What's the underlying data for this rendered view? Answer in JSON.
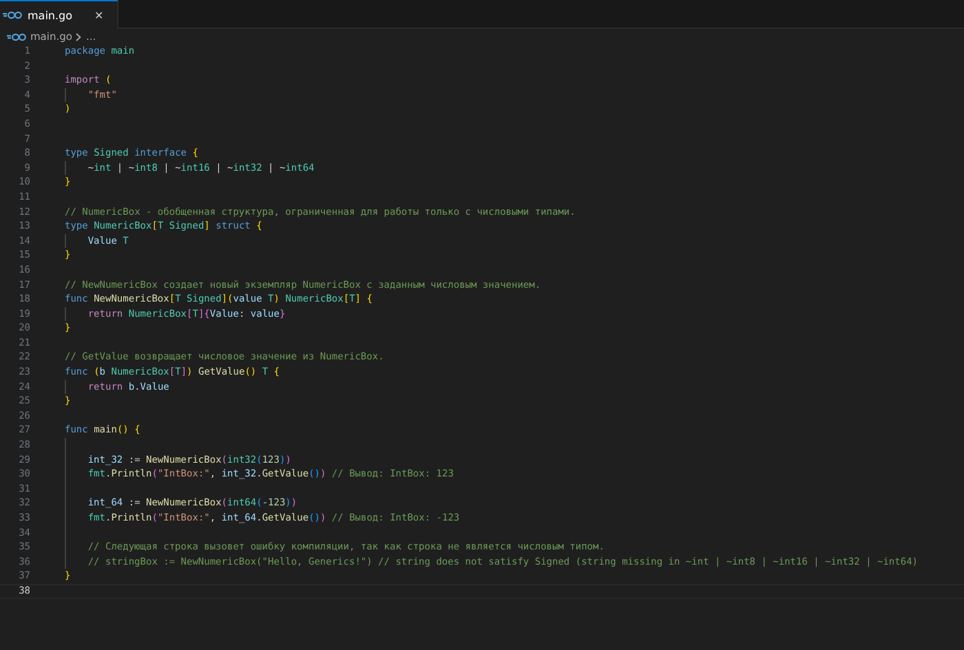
{
  "tabs": [
    {
      "label": "main.go",
      "selected": true,
      "close": "✕"
    }
  ],
  "breadcrumb": {
    "file": "main.go",
    "rest": "..."
  },
  "lines": [
    {
      "number": "1",
      "current": false,
      "indented": false,
      "tokens": [
        {
          "kind": "kw",
          "text": "package "
        },
        {
          "kind": "type",
          "text": "main"
        }
      ]
    },
    {
      "number": "2",
      "current": false,
      "indented": false
    },
    {
      "number": "3",
      "current": false,
      "indented": false,
      "tokens": [
        {
          "kind": "ctrl",
          "text": "import "
        },
        {
          "kind": "br1",
          "text": "("
        }
      ]
    },
    {
      "number": "4",
      "current": false,
      "indented": true,
      "tokens": [
        {
          "kind": "str",
          "text": "\"fmt\""
        }
      ]
    },
    {
      "number": "5",
      "current": false,
      "indented": false,
      "tokens": [
        {
          "kind": "br1",
          "text": ")"
        }
      ]
    },
    {
      "number": "6",
      "current": false,
      "indented": false
    },
    {
      "number": "7",
      "current": false,
      "indented": false
    },
    {
      "number": "8",
      "current": false,
      "indented": false,
      "tokens": [
        {
          "kind": "kw",
          "text": "type "
        },
        {
          "kind": "type",
          "text": "Signed "
        },
        {
          "kind": "kw",
          "text": "interface "
        },
        {
          "kind": "br1",
          "text": "{"
        }
      ]
    },
    {
      "number": "9",
      "current": false,
      "indented": true,
      "tokens": [
        {
          "kind": "punct",
          "text": "~"
        },
        {
          "kind": "type",
          "text": "int"
        },
        {
          "kind": "punct",
          "text": " | ~"
        },
        {
          "kind": "type",
          "text": "int8"
        },
        {
          "kind": "punct",
          "text": " | ~"
        },
        {
          "kind": "type",
          "text": "int16"
        },
        {
          "kind": "punct",
          "text": " | ~"
        },
        {
          "kind": "type",
          "text": "int32"
        },
        {
          "kind": "punct",
          "text": " | ~"
        },
        {
          "kind": "type",
          "text": "int64"
        }
      ]
    },
    {
      "number": "10",
      "current": false,
      "indented": false,
      "tokens": [
        {
          "kind": "br1",
          "text": "}"
        }
      ]
    },
    {
      "number": "11",
      "current": false,
      "indented": false
    },
    {
      "number": "12",
      "current": false,
      "indented": false,
      "tokens": [
        {
          "kind": "cm",
          "text": "// NumericBox - обобщенная структура, ограниченная для работы только с числовыми типами."
        }
      ]
    },
    {
      "number": "13",
      "current": false,
      "indented": false,
      "tokens": [
        {
          "kind": "kw",
          "text": "type "
        },
        {
          "kind": "type",
          "text": "NumericBox"
        },
        {
          "kind": "br1",
          "text": "["
        },
        {
          "kind": "type",
          "text": "T Signed"
        },
        {
          "kind": "br1",
          "text": "]"
        },
        {
          "kind": "kw",
          "text": " struct "
        },
        {
          "kind": "br1",
          "text": "{"
        }
      ]
    },
    {
      "number": "14",
      "current": false,
      "indented": true,
      "tokens": [
        {
          "kind": "var",
          "text": "Value "
        },
        {
          "kind": "type",
          "text": "T"
        }
      ]
    },
    {
      "number": "15",
      "current": false,
      "indented": false,
      "tokens": [
        {
          "kind": "br1",
          "text": "}"
        }
      ]
    },
    {
      "number": "16",
      "current": false,
      "indented": false
    },
    {
      "number": "17",
      "current": false,
      "indented": false,
      "tokens": [
        {
          "kind": "cm",
          "text": "// NewNumericBox создает новый экземпляр NumericBox с заданным числовым значением."
        }
      ]
    },
    {
      "number": "18",
      "current": false,
      "indented": false,
      "tokens": [
        {
          "kind": "kw",
          "text": "func "
        },
        {
          "kind": "fn",
          "text": "NewNumericBox"
        },
        {
          "kind": "br1",
          "text": "["
        },
        {
          "kind": "type",
          "text": "T Signed"
        },
        {
          "kind": "br1",
          "text": "]("
        },
        {
          "kind": "var",
          "text": "value "
        },
        {
          "kind": "type",
          "text": "T"
        },
        {
          "kind": "br1",
          "text": ")"
        },
        {
          "kind": "type",
          "text": " NumericBox"
        },
        {
          "kind": "br1",
          "text": "["
        },
        {
          "kind": "type",
          "text": "T"
        },
        {
          "kind": "br1",
          "text": "] {"
        }
      ]
    },
    {
      "number": "19",
      "current": false,
      "indented": true,
      "tokens": [
        {
          "kind": "ctrl",
          "text": "return "
        },
        {
          "kind": "type",
          "text": "NumericBox"
        },
        {
          "kind": "br2",
          "text": "["
        },
        {
          "kind": "type",
          "text": "T"
        },
        {
          "kind": "br2",
          "text": "]{"
        },
        {
          "kind": "var",
          "text": "Value"
        },
        {
          "kind": "punct",
          "text": ": "
        },
        {
          "kind": "var",
          "text": "value"
        },
        {
          "kind": "br2",
          "text": "}"
        }
      ]
    },
    {
      "number": "20",
      "current": false,
      "indented": false,
      "tokens": [
        {
          "kind": "br1",
          "text": "}"
        }
      ]
    },
    {
      "number": "21",
      "current": false,
      "indented": false
    },
    {
      "number": "22",
      "current": false,
      "indented": false,
      "tokens": [
        {
          "kind": "cm",
          "text": "// GetValue возвращает числовое значение из NumericBox."
        }
      ]
    },
    {
      "number": "23",
      "current": false,
      "indented": false,
      "tokens": [
        {
          "kind": "kw",
          "text": "func "
        },
        {
          "kind": "br1",
          "text": "("
        },
        {
          "kind": "var",
          "text": "b "
        },
        {
          "kind": "type",
          "text": "NumericBox"
        },
        {
          "kind": "br2",
          "text": "["
        },
        {
          "kind": "type",
          "text": "T"
        },
        {
          "kind": "br2",
          "text": "]"
        },
        {
          "kind": "br1",
          "text": ")"
        },
        {
          "kind": "fn",
          "text": " GetValue"
        },
        {
          "kind": "br1",
          "text": "()"
        },
        {
          "kind": "type",
          "text": " T"
        },
        {
          "kind": "br1",
          "text": " {"
        }
      ]
    },
    {
      "number": "24",
      "current": false,
      "indented": true,
      "tokens": [
        {
          "kind": "ctrl",
          "text": "return "
        },
        {
          "kind": "var",
          "text": "b"
        },
        {
          "kind": "punct",
          "text": "."
        },
        {
          "kind": "var",
          "text": "Value"
        }
      ]
    },
    {
      "number": "25",
      "current": false,
      "indented": false,
      "tokens": [
        {
          "kind": "br1",
          "text": "}"
        }
      ]
    },
    {
      "number": "26",
      "current": false,
      "indented": false
    },
    {
      "number": "27",
      "current": false,
      "indented": false,
      "tokens": [
        {
          "kind": "kw",
          "text": "func "
        },
        {
          "kind": "fn",
          "text": "main"
        },
        {
          "kind": "br1",
          "text": "() {"
        }
      ]
    },
    {
      "number": "28",
      "current": false,
      "indented": true
    },
    {
      "number": "29",
      "current": false,
      "indented": true,
      "tokens": [
        {
          "kind": "var",
          "text": "int_32"
        },
        {
          "kind": "punct",
          "text": " := "
        },
        {
          "kind": "fn",
          "text": "NewNumericBox"
        },
        {
          "kind": "br2",
          "text": "("
        },
        {
          "kind": "type",
          "text": "int32"
        },
        {
          "kind": "br3",
          "text": "("
        },
        {
          "kind": "num",
          "text": "123"
        },
        {
          "kind": "br3",
          "text": ")"
        },
        {
          "kind": "br2",
          "text": ")"
        }
      ]
    },
    {
      "number": "30",
      "current": false,
      "indented": true,
      "tokens": [
        {
          "kind": "type",
          "text": "fmt"
        },
        {
          "kind": "punct",
          "text": "."
        },
        {
          "kind": "fn",
          "text": "Println"
        },
        {
          "kind": "br2",
          "text": "("
        },
        {
          "kind": "str",
          "text": "\"IntBox:\""
        },
        {
          "kind": "punct",
          "text": ", "
        },
        {
          "kind": "var",
          "text": "int_32"
        },
        {
          "kind": "punct",
          "text": "."
        },
        {
          "kind": "fn",
          "text": "GetValue"
        },
        {
          "kind": "br3",
          "text": "()"
        },
        {
          "kind": "br2",
          "text": ")"
        },
        {
          "kind": "cm",
          "text": " // Вывод: IntBox: 123"
        }
      ]
    },
    {
      "number": "31",
      "current": false,
      "indented": true
    },
    {
      "number": "32",
      "current": false,
      "indented": true,
      "tokens": [
        {
          "kind": "var",
          "text": "int_64"
        },
        {
          "kind": "punct",
          "text": " := "
        },
        {
          "kind": "fn",
          "text": "NewNumericBox"
        },
        {
          "kind": "br2",
          "text": "("
        },
        {
          "kind": "type",
          "text": "int64"
        },
        {
          "kind": "br3",
          "text": "("
        },
        {
          "kind": "num",
          "text": "-123"
        },
        {
          "kind": "br3",
          "text": ")"
        },
        {
          "kind": "br2",
          "text": ")"
        }
      ]
    },
    {
      "number": "33",
      "current": false,
      "indented": true,
      "tokens": [
        {
          "kind": "type",
          "text": "fmt"
        },
        {
          "kind": "punct",
          "text": "."
        },
        {
          "kind": "fn",
          "text": "Println"
        },
        {
          "kind": "br2",
          "text": "("
        },
        {
          "kind": "str",
          "text": "\"IntBox:\""
        },
        {
          "kind": "punct",
          "text": ", "
        },
        {
          "kind": "var",
          "text": "int_64"
        },
        {
          "kind": "punct",
          "text": "."
        },
        {
          "kind": "fn",
          "text": "GetValue"
        },
        {
          "kind": "br3",
          "text": "()"
        },
        {
          "kind": "br2",
          "text": ")"
        },
        {
          "kind": "cm",
          "text": " // Вывод: IntBox: -123"
        }
      ]
    },
    {
      "number": "34",
      "current": false,
      "indented": true
    },
    {
      "number": "35",
      "current": false,
      "indented": true,
      "tokens": [
        {
          "kind": "cm",
          "text": "// Следующая строка вызовет ошибку компиляции, так как строка не является числовым типом."
        }
      ]
    },
    {
      "number": "36",
      "current": false,
      "indented": true,
      "tokens": [
        {
          "kind": "cm",
          "text": "// stringBox := NewNumericBox(\"Hello, Generics!\") // string does not satisfy Signed (string missing in ~int | ~int8 | ~int16 | ~int32 | ~int64)"
        }
      ]
    },
    {
      "number": "37",
      "current": false,
      "indented": false,
      "tokens": [
        {
          "kind": "br1",
          "text": "}"
        }
      ]
    },
    {
      "number": "38",
      "current": true,
      "indented": false
    }
  ]
}
